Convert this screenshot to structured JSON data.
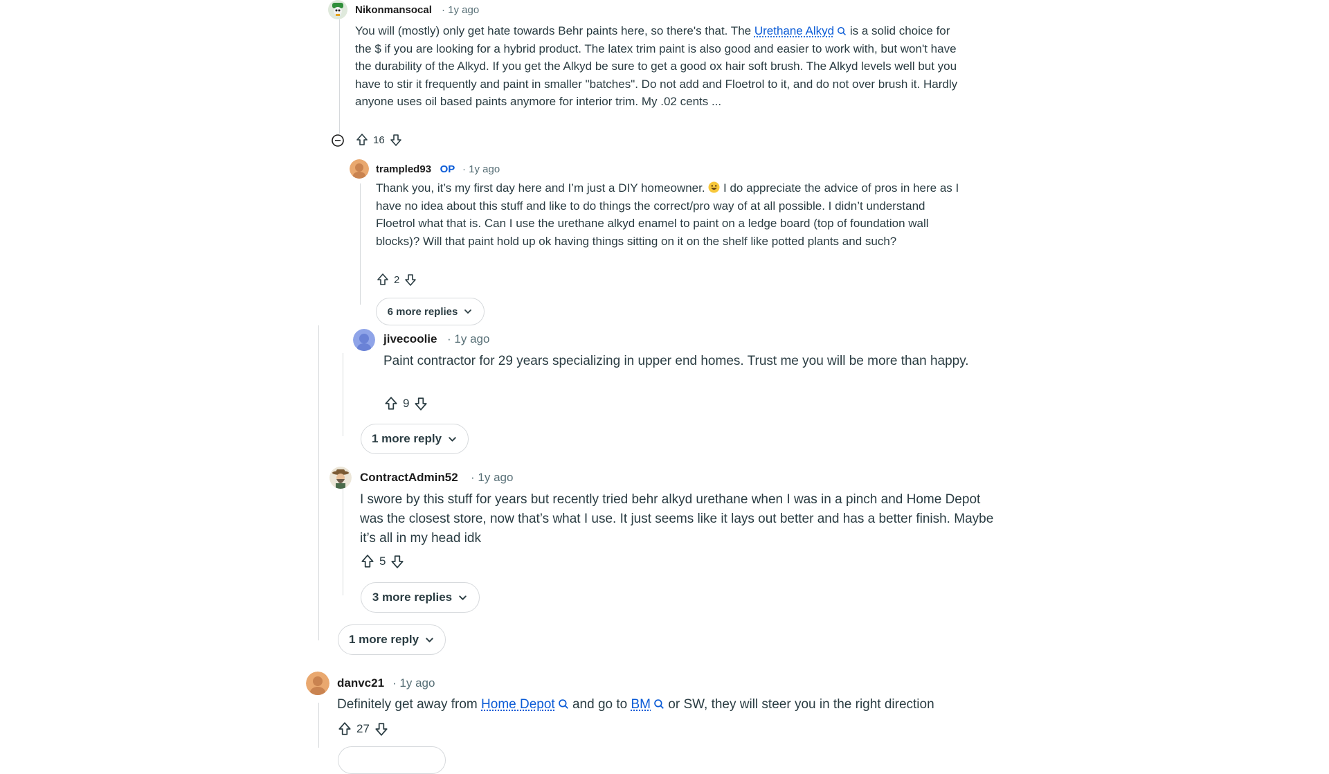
{
  "comments": {
    "c1": {
      "author": "Nikonmansocal",
      "time": "1y ago",
      "body_pre": "You will (mostly) only get hate towards Behr paints here, so there's that. The ",
      "link": "Urethane Alkyd",
      "body_post": " is a solid choice for the $ if you are looking for a hybrid product. The latex trim paint is also good and easier to work with, but won't have the durability of the Alkyd. If you get the Alkyd be sure to get a good ox hair soft brush. The Alkyd levels well but you have to stir it frequently and paint in smaller \"batches\". Do not add and Floetrol to it, and do not over brush it. Hardly anyone uses oil based paints anymore for interior trim. My .02 cents ...",
      "votes": "16"
    },
    "c2": {
      "author": "trampled93",
      "op_badge": "OP",
      "time": "1y ago",
      "body_pre": "Thank you, it’s my first day here and I’m just a DIY homeowner. ",
      "body_post": " I do appreciate the advice of pros in here as I have no idea about this stuff and like to do things the correct/pro way of at all possible. I didn’t understand Floetrol what that is. Can I use the urethane alkyd enamel to paint on a ledge board (top of foundation wall blocks)? Will that paint hold up ok having things sitting on it on the shelf like potted plants and such?",
      "votes": "2",
      "more": "6 more replies"
    },
    "c3": {
      "author": "jivecoolie",
      "time": "1y ago",
      "body": "Paint contractor for 29 years specializing in upper end homes. Trust me you will be more than happy.",
      "votes": "9",
      "more": "1 more reply"
    },
    "c4": {
      "author": "ContractAdmin52",
      "time": "1y ago",
      "body": "I swore by this stuff for years but recently tried behr alkyd urethane when I was in a pinch and Home Depot was the closest store, now that’s what I use. It just seems like it lays out better and has a better finish. Maybe it’s all in my head idk",
      "votes": "5",
      "more": "3 more replies"
    },
    "outer_more": "1 more reply",
    "c5": {
      "author": "danvc21",
      "time": "1y ago",
      "body_pre": "Definitely get away from ",
      "link1": "Home Depot",
      "body_mid": " and go to ",
      "link2": "BM",
      "body_post": " or SW, they will steer you in the right direction",
      "votes": "27"
    }
  },
  "icons": {
    "upvote": "arrow-up-outline-icon",
    "downvote": "arrow-down-outline-icon",
    "search": "search-icon",
    "collapse": "minus-circle-icon",
    "chevron": "chevron-down-icon",
    "emoji": "grinning-face-icon"
  },
  "colors": {
    "link": "#0a5bd6",
    "meta": "#576f76",
    "thread": "#d6d9dc"
  }
}
